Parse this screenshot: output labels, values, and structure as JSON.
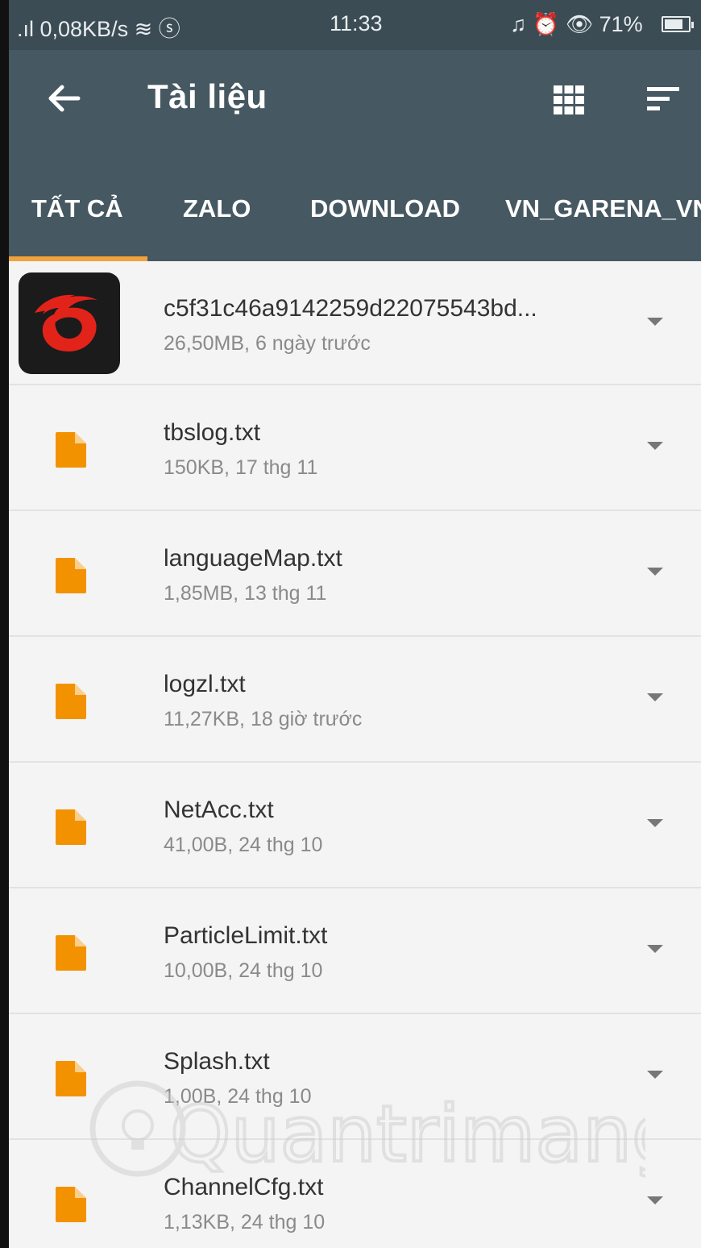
{
  "status_bar": {
    "left": ".ıl 0,08KB/s ≋ ⓢ",
    "time": "11:33",
    "right": "♫ ⏰ 👁 71%"
  },
  "app_bar": {
    "title": "Tài liệu"
  },
  "tabs": [
    {
      "label": "TẤT CẢ",
      "active": true
    },
    {
      "label": "ZALO",
      "active": false
    },
    {
      "label": "DOWNLOAD",
      "active": false
    },
    {
      "label": "VN_GARENA_VN",
      "active": false
    }
  ],
  "files": [
    {
      "name": "c5f31c46a9142259d22075543bd...",
      "meta": "26,50MB, 6 ngày trước",
      "icon": "garena-app-icon"
    },
    {
      "name": "tbslog.txt",
      "meta": "150KB, 17 thg 11",
      "icon": "document-icon"
    },
    {
      "name": "languageMap.txt",
      "meta": "1,85MB, 13 thg 11",
      "icon": "document-icon"
    },
    {
      "name": "logzl.txt",
      "meta": "11,27KB, 18 giờ trước",
      "icon": "document-icon"
    },
    {
      "name": "NetAcc.txt",
      "meta": "41,00B, 24 thg 10",
      "icon": "document-icon"
    },
    {
      "name": "ParticleLimit.txt",
      "meta": "10,00B, 24 thg 10",
      "icon": "document-icon"
    },
    {
      "name": "Splash.txt",
      "meta": "1,00B, 24 thg 10",
      "icon": "document-icon"
    },
    {
      "name": "ChannelCfg.txt",
      "meta": "1,13KB, 24 thg 10",
      "icon": "document-icon"
    }
  ],
  "watermark": "Quantrimang",
  "colors": {
    "status_bar": "#3c4c55",
    "app_bar": "#465861",
    "accent": "#f0a33a",
    "file_icon": "#f39200"
  }
}
